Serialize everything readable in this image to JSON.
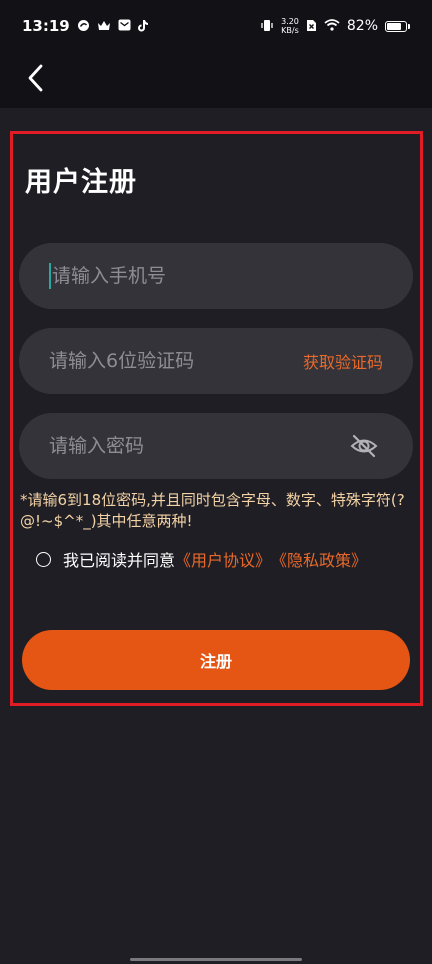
{
  "status_bar": {
    "time": "13:19",
    "net_speed_value": "3.20",
    "net_speed_unit": "KB/s",
    "battery_percent": "82%",
    "battery_level": 0.82
  },
  "page": {
    "title": "用户注册"
  },
  "form": {
    "phone_placeholder": "请输入手机号",
    "code_placeholder": "请输入6位验证码",
    "get_code_label": "获取验证码",
    "password_placeholder": "请输入密码",
    "password_hint": "*请输6到18位密码,并且同时包含字母、数字、特殊字符(?@!~$^*_)其中任意两种!",
    "agree_prefix": "我已阅读并同意",
    "user_agreement": "《用户协议》",
    "privacy_policy": "《隐私政策》",
    "submit_label": "注册"
  },
  "colors": {
    "accent": "#e55614",
    "link": "#e8692a",
    "hint": "#f3d3a6",
    "highlight_border": "#e01d24"
  }
}
